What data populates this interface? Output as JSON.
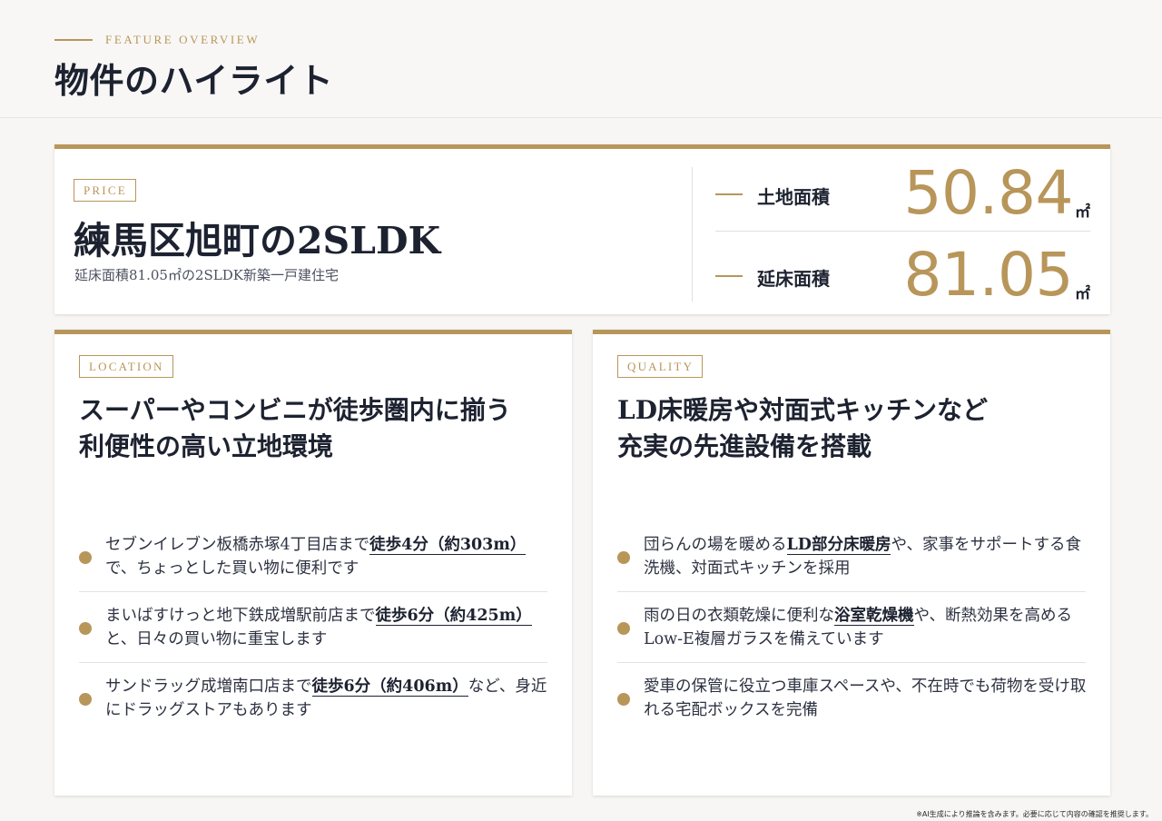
{
  "header": {
    "eyebrow": "FEATURE OVERVIEW",
    "title": "物件のハイライト"
  },
  "price": {
    "tag": "PRICE",
    "title": "練馬区旭町の2SLDK",
    "subtitle": "延床面積81.05㎡の2SLDK新築一戸建住宅",
    "stats": [
      {
        "label": "土地面積",
        "value": "50.84",
        "unit": "㎡"
      },
      {
        "label": "延床面積",
        "value": "81.05",
        "unit": "㎡"
      }
    ]
  },
  "location": {
    "tag": "LOCATION",
    "heading": [
      "スーパーやコンビニが徒歩圏内に揃う",
      "利便性の高い立地環境"
    ],
    "bullets": [
      {
        "before": "セブンイレブン板橋赤塚4丁目店まで",
        "highlight": "徒歩4分（約303m）",
        "after": "で、ちょっとした買い物に便利です"
      },
      {
        "before": "まいばすけっと地下鉄成増駅前店まで",
        "highlight": "徒歩6分（約425m）",
        "after": "と、日々の買い物に重宝します"
      },
      {
        "before": "サンドラッグ成増南口店まで",
        "highlight": "徒歩6分（約406m）",
        "after": "など、身近にドラッグストアもあります"
      }
    ]
  },
  "quality": {
    "tag": "QUALITY",
    "heading": [
      "LD床暖房や対面式キッチンなど",
      "充実の先進設備を搭載"
    ],
    "bullets": [
      {
        "before": "団らんの場を暖める",
        "highlight": "LD部分床暖房",
        "after": "や、家事をサポートする食洗機、対面式キッチンを採用"
      },
      {
        "before": "雨の日の衣類乾燥に便利な",
        "highlight": "浴室乾燥機",
        "after": "や、断熱効果を高めるLow-E複層ガラスを備えています"
      },
      {
        "before": "愛車の保管に役立つ車庫スペースや、不在時でも荷物を受け取れる宅配ボックスを完備",
        "highlight": "",
        "after": ""
      }
    ]
  },
  "footnote": "※AI生成により推論を含みます。必要に応じて内容の確認を推奨します。",
  "colors": {
    "accent": "#b8965a",
    "text": "#1d2230",
    "background": "#f7f6f4"
  }
}
